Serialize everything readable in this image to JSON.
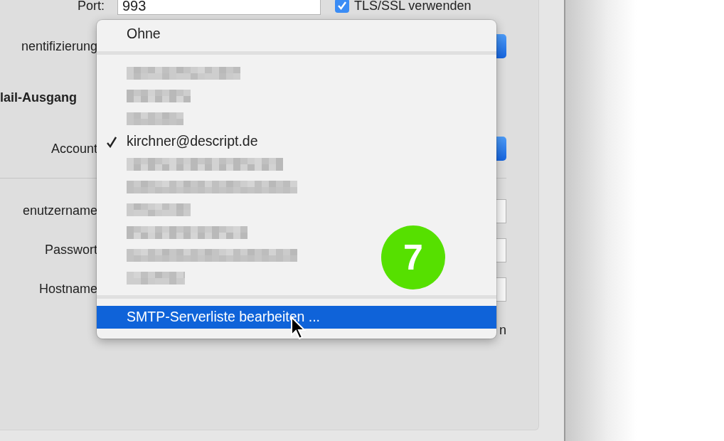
{
  "form": {
    "port": {
      "label": "Port:",
      "value": "993"
    },
    "tls": {
      "label": "TLS/SSL verwenden",
      "checked": true
    },
    "rows": [
      {
        "kind": "popup",
        "label": "nentifizierung"
      },
      {
        "kind": "heading",
        "label": "lail-Ausgang"
      },
      {
        "kind": "popup",
        "label": "Account"
      },
      {
        "kind": "divider"
      },
      {
        "kind": "field",
        "label": "enutzername"
      },
      {
        "kind": "field",
        "label": "Passwort"
      },
      {
        "kind": "field",
        "label": "Hostname"
      },
      {
        "kind": "trailing",
        "label": "n"
      }
    ]
  },
  "menu": {
    "items": [
      {
        "kind": "option",
        "label": "Ohne",
        "checked": false,
        "selected": false
      },
      {
        "kind": "separator"
      },
      {
        "kind": "redacted"
      },
      {
        "kind": "redacted"
      },
      {
        "kind": "redacted"
      },
      {
        "kind": "option",
        "label": "kirchner@descript.de",
        "checked": true,
        "selected": false
      },
      {
        "kind": "redacted"
      },
      {
        "kind": "redacted"
      },
      {
        "kind": "redacted"
      },
      {
        "kind": "redacted"
      },
      {
        "kind": "redacted"
      },
      {
        "kind": "redacted"
      },
      {
        "kind": "separator"
      },
      {
        "kind": "option",
        "label": "SMTP-Serverliste bearbeiten ...",
        "checked": false,
        "selected": true
      }
    ]
  },
  "step_badge": {
    "text": "7"
  }
}
